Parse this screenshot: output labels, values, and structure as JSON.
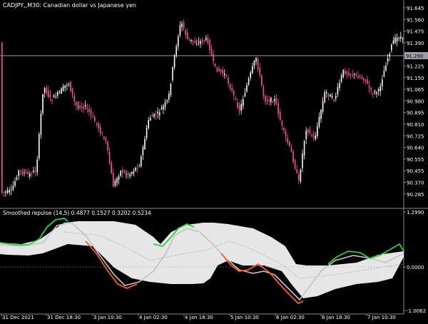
{
  "main_chart": {
    "title": "CADJPY,,M30:  Canadian dollar vs Japanese yen",
    "axis_labels": [
      "91.645",
      "91.560",
      "91.475",
      "91.390",
      "91.290",
      "91.225",
      "91.150",
      "91.065",
      "90.980",
      "90.895",
      "90.810",
      "90.725",
      "90.640",
      "90.555",
      "90.455",
      "90.370",
      "90.285"
    ],
    "current_price_label": "91.290"
  },
  "indicator": {
    "title": "Smoothed repulse (14,5) 0.4877 0.1527 0.3202 0.5234",
    "axis_labels": [
      "1.2990",
      "0.0000",
      "-1.0062"
    ]
  },
  "time_axis": {
    "labels": [
      "31 Dec 2021",
      "31 Dec 18:30",
      "3 Jan 10:30",
      "4 Jan 02:30",
      "4 Jan 18:30",
      "5 Jan 10:30",
      "6 Jan 02:30",
      "6 Jan 18:30",
      "7 Jan 10:30"
    ]
  },
  "colors": {
    "background": "#000000",
    "candle_up": "#ffffff",
    "candle_down": "#ff4fa0",
    "separator": "#8a8a8a",
    "current_price_line": "#9aa0a6",
    "band_fill": "#e6e6e6",
    "signal_up": "#2ecc40",
    "signal_down": "#ff5a1f",
    "text": "#ffffff"
  }
}
